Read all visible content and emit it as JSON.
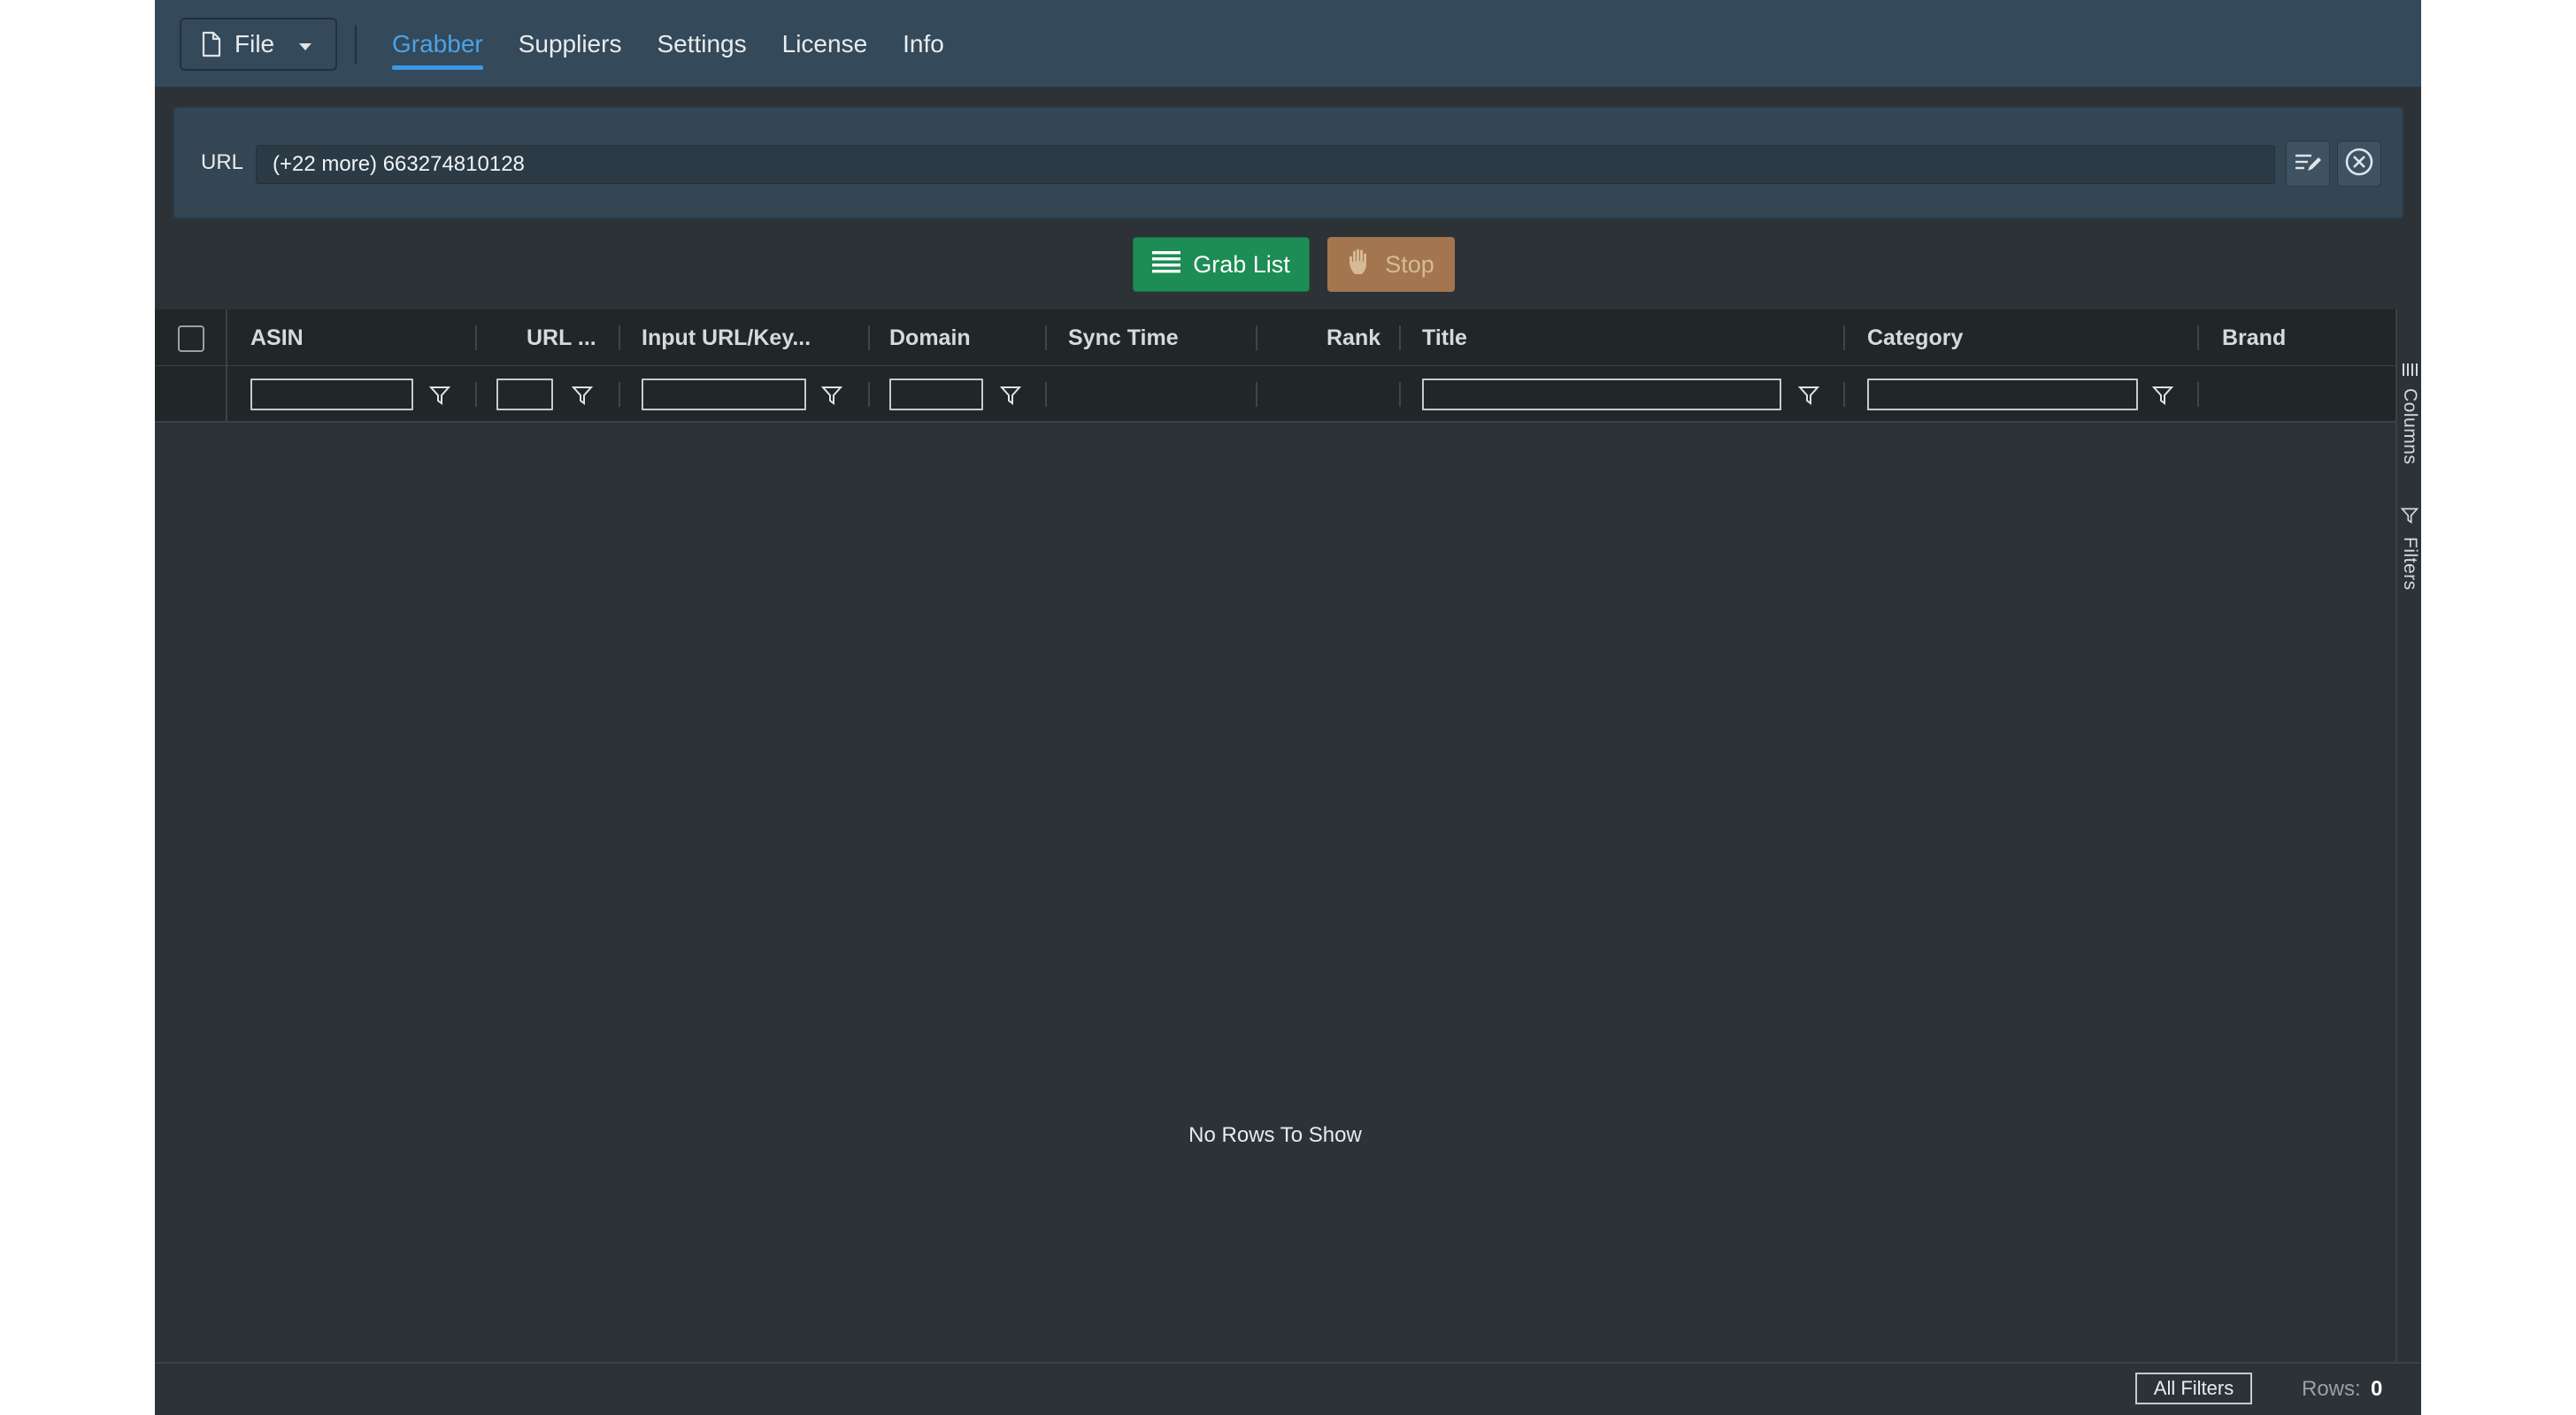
{
  "toolbar": {
    "file_label": "File",
    "file_icon": "document-icon",
    "tabs": [
      {
        "label": "Grabber",
        "active": true
      },
      {
        "label": "Suppliers",
        "active": false
      },
      {
        "label": "Settings",
        "active": false
      },
      {
        "label": "License",
        "active": false
      },
      {
        "label": "Info",
        "active": false
      }
    ]
  },
  "url_bar": {
    "label": "URL",
    "value": "(+22 more) 663274810128",
    "edit_icon": "edit-list-icon",
    "clear_icon": "clear-circle-icon"
  },
  "actions": {
    "grab_label": "Grab List",
    "grab_icon": "list-icon",
    "stop_label": "Stop",
    "stop_icon": "hand-icon",
    "stop_enabled": false
  },
  "grid": {
    "columns": [
      {
        "label": "ASIN",
        "filterable": true
      },
      {
        "label": "URL ...",
        "filterable": true
      },
      {
        "label": "Input URL/Key...",
        "filterable": true
      },
      {
        "label": "Domain",
        "filterable": true
      },
      {
        "label": "Sync Time",
        "filterable": false
      },
      {
        "label": "Rank",
        "filterable": false
      },
      {
        "label": "Title",
        "filterable": true
      },
      {
        "label": "Category",
        "filterable": true
      },
      {
        "label": "Brand",
        "filterable": false
      }
    ],
    "empty_message": "No Rows To Show",
    "side_panel": {
      "columns_label": "Columns",
      "filters_label": "Filters"
    }
  },
  "status": {
    "all_filters_label": "All Filters",
    "rows_label": "Rows:",
    "rows_value": "0"
  },
  "colors": {
    "accent": "#3a98e6",
    "grab_button": "#1d8c55",
    "stop_button": "#a37650",
    "header_bg": "#34495a"
  }
}
